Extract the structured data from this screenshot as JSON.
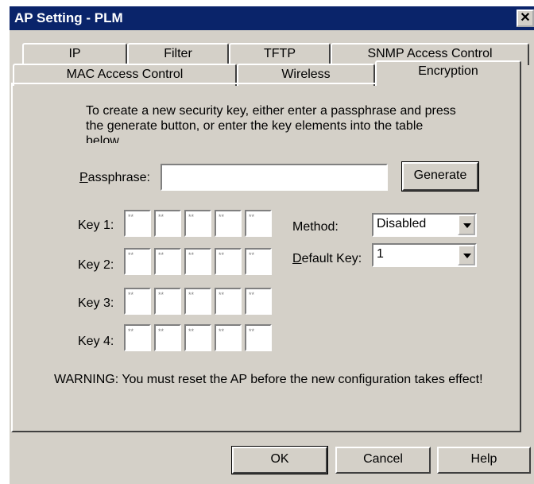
{
  "window": {
    "title": "AP Setting - PLM",
    "close_glyph": "✕"
  },
  "tabs_row1": [
    "IP",
    "Filter",
    "TFTP",
    "SNMP Access Control"
  ],
  "tabs_row2": [
    "MAC Access Control",
    "Wireless",
    "Encryption"
  ],
  "active_tab": "Encryption",
  "intro": "To create a new security key, either enter a passphrase and press the generate button, or enter the key elements into the table below",
  "passphrase": {
    "label_u": "P",
    "label_rest": "assphrase:",
    "value": ""
  },
  "generate_label": "Generate",
  "keys": [
    {
      "label": "Key 1:",
      "cells": [
        "**",
        "**",
        "**",
        "**",
        "**"
      ]
    },
    {
      "label": "Key 2:",
      "cells": [
        "**",
        "**",
        "**",
        "**",
        "**"
      ]
    },
    {
      "label": "Key 3:",
      "cells": [
        "**",
        "**",
        "**",
        "**",
        "**"
      ]
    },
    {
      "label": "Key 4:",
      "cells": [
        "**",
        "**",
        "**",
        "**",
        "**"
      ]
    }
  ],
  "method": {
    "label": "Method:",
    "value": "Disabled"
  },
  "default_key": {
    "label_u": "D",
    "label_rest": "efault Key:",
    "value": "1"
  },
  "warning": "WARNING: You must reset the AP before the new configuration takes effect!",
  "buttons": {
    "ok": "OK",
    "cancel": "Cancel",
    "help": "Help"
  }
}
